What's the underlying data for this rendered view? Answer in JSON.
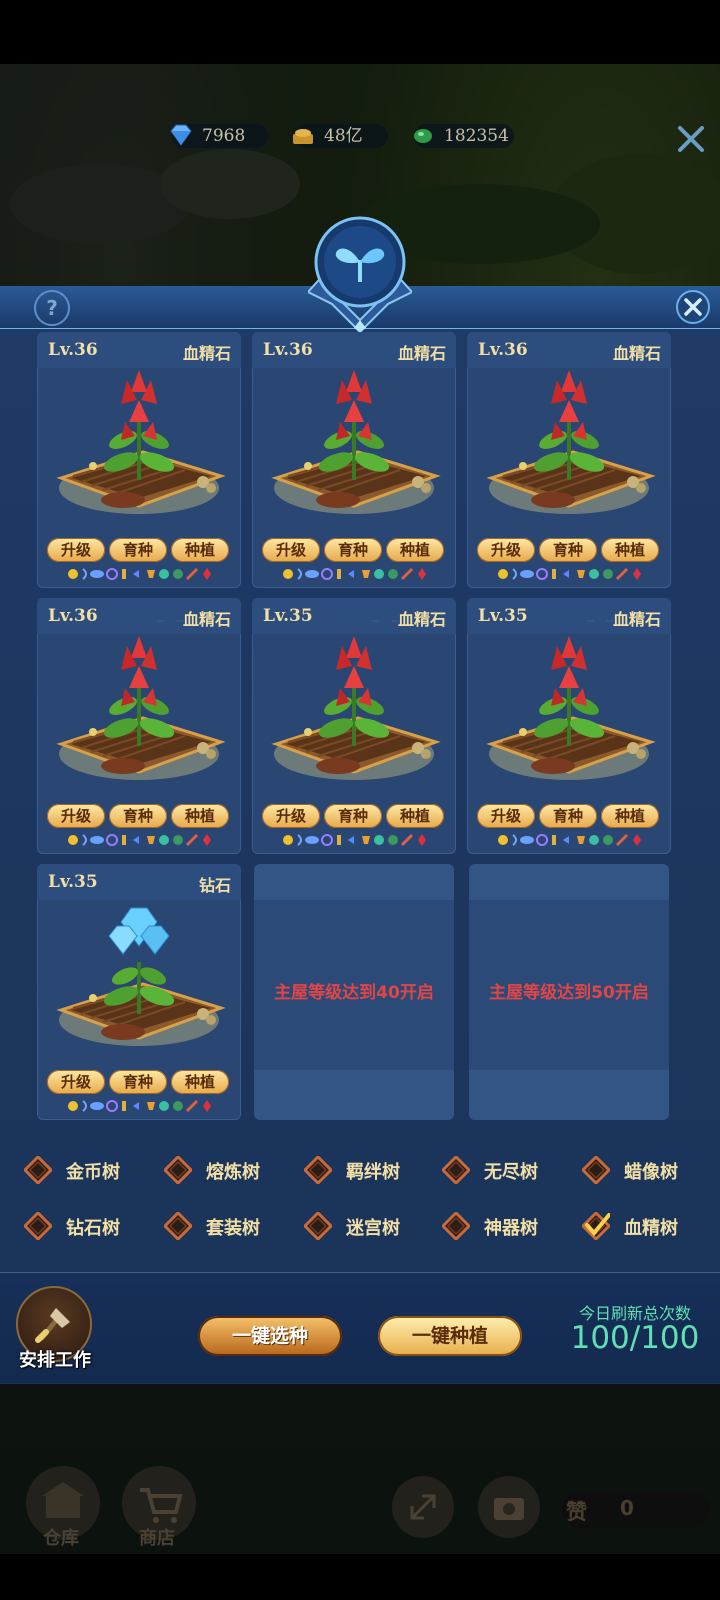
{
  "resources": [
    {
      "icon": "diamond-icon",
      "value": "7968"
    },
    {
      "icon": "gold-coin-icon",
      "value": "48亿"
    },
    {
      "icon": "green-gem-icon",
      "value": "182354"
    }
  ],
  "panel": {
    "help_icon": "question-icon",
    "close_icon": "close-icon",
    "emblem_icon": "sprout-icon"
  },
  "plots": [
    {
      "level": "Lv.36",
      "kind": "血精石",
      "crop": "blood-crystal"
    },
    {
      "level": "Lv.36",
      "kind": "血精石",
      "crop": "blood-crystal"
    },
    {
      "level": "Lv.36",
      "kind": "血精石",
      "crop": "blood-crystal"
    },
    {
      "level": "Lv.36",
      "kind": "血精石",
      "crop": "blood-crystal"
    },
    {
      "level": "Lv.35",
      "kind": "血精石",
      "crop": "blood-crystal"
    },
    {
      "level": "Lv.35",
      "kind": "血精石",
      "crop": "blood-crystal"
    },
    {
      "level": "Lv.35",
      "kind": "钻石",
      "crop": "diamond"
    }
  ],
  "plot_buttons": {
    "upgrade": "升级",
    "breed": "育种",
    "plant": "种植"
  },
  "locked_plots": [
    {
      "text": "主屋等级达到40开启"
    },
    {
      "text": "主屋等级达到50开启"
    }
  ],
  "tree_filters": [
    {
      "label": "金币树",
      "checked": false
    },
    {
      "label": "熔炼树",
      "checked": false
    },
    {
      "label": "羁绊树",
      "checked": false
    },
    {
      "label": "无尽树",
      "checked": false
    },
    {
      "label": "蜡像树",
      "checked": false
    },
    {
      "label": "钻石树",
      "checked": false
    },
    {
      "label": "套装树",
      "checked": false
    },
    {
      "label": "迷宫树",
      "checked": false
    },
    {
      "label": "神器树",
      "checked": false
    },
    {
      "label": "血精树",
      "checked": true
    }
  ],
  "actions": {
    "work_label": "安排工作",
    "one_click_select": "一键选种",
    "one_click_plant": "一键种植",
    "refresh_label": "今日刷新总次数",
    "refresh_count": "100/100"
  },
  "hud": {
    "warehouse": "仓库",
    "shop": "商店",
    "like_label": "赞",
    "like_count": "0"
  },
  "colors": {
    "panel_bg": "#1e3a66",
    "gold_text": "#f1dfa6",
    "locked_text": "#e04646",
    "refresh_text": "#5fe0b5",
    "button_gold": "#e7a94a"
  }
}
